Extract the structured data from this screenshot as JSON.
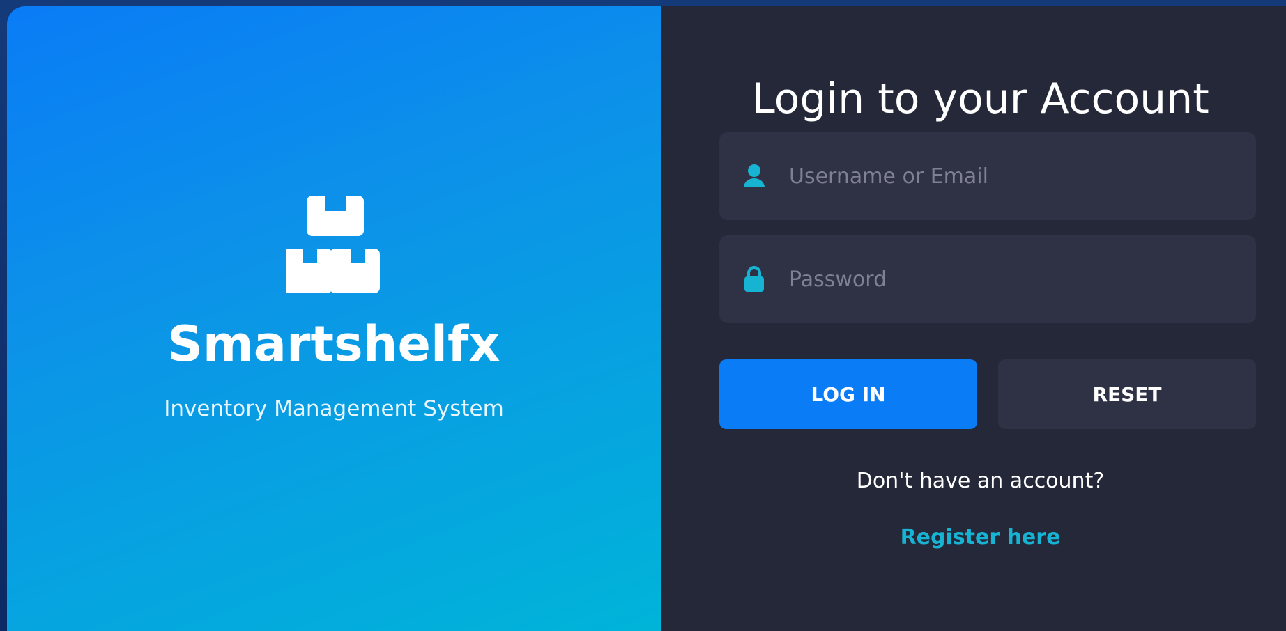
{
  "brand": {
    "logo_icon": "boxes-icon",
    "name": "Smartshelfx",
    "tagline": "Inventory Management System"
  },
  "login": {
    "title": "Login to your Account",
    "username": {
      "icon": "user-icon",
      "placeholder": "Username or Email",
      "value": ""
    },
    "password": {
      "icon": "lock-icon",
      "placeholder": "Password",
      "value": ""
    },
    "login_label": "LOG IN",
    "reset_label": "RESET",
    "no_account_text": "Don't have an account?",
    "register_label": "Register here"
  },
  "colors": {
    "brand_gradient_start": "#0a7cf6",
    "brand_gradient_end": "#00b4d8",
    "panel_bg": "#252839",
    "field_bg": "#2f3145",
    "accent": "#0a7cf6",
    "link": "#16b4d2",
    "icon": "#16b4d2"
  }
}
